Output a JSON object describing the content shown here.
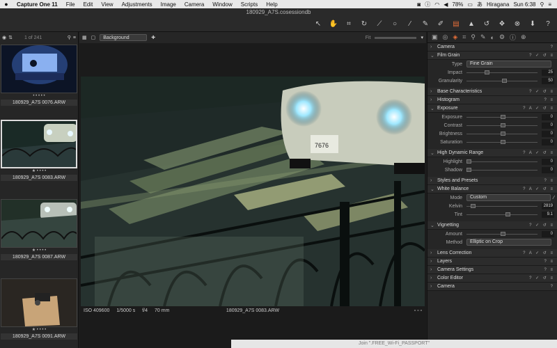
{
  "menubar": {
    "app": "Capture One 11",
    "items": [
      "File",
      "Edit",
      "View",
      "Adjustments",
      "Image",
      "Camera",
      "Window",
      "Scripts",
      "Help"
    ],
    "battery": "78%",
    "input_source": "Hiragana",
    "clock": "Sun 6:38"
  },
  "window": {
    "title": "180929_A7S.cosessiondb"
  },
  "browser": {
    "count": "1 of 241",
    "thumbs": [
      {
        "stars": "• • • • •",
        "name": "180929_A7S 0076.ARW"
      },
      {
        "stars": "★ • • • •",
        "name": "180929_A7S 0083.ARW"
      },
      {
        "stars": "★ • • • •",
        "name": "180929_A7S 0087.ARW"
      },
      {
        "stars": "★ • • • •",
        "name": "180929_A7S 0091.ARW"
      }
    ]
  },
  "viewer": {
    "layer_select": "Background",
    "fit_label": "Fit",
    "iso": "ISO 409600",
    "shutter": "1/5000 s",
    "aperture": "f/4",
    "focal": "70 mm",
    "filename": "180929_A7S 0083.ARW"
  },
  "tools": {
    "camera": "Camera",
    "film_grain": {
      "title": "Film Grain",
      "type_label": "Type",
      "type_value": "Fine Grain",
      "impact_label": "Impact",
      "impact_value": "25",
      "granularity_label": "Granularity",
      "granularity_value": "50"
    },
    "base_char": "Base Characteristics",
    "histogram": "Histogram",
    "exposure": {
      "title": "Exposure",
      "exposure_label": "Exposure",
      "exposure_value": "0",
      "contrast_label": "Contrast",
      "contrast_value": "0",
      "brightness_label": "Brightness",
      "brightness_value": "0",
      "saturation_label": "Saturation",
      "saturation_value": "0"
    },
    "hdr": {
      "title": "High Dynamic Range",
      "highlight_label": "Highlight",
      "highlight_value": "0",
      "shadow_label": "Shadow",
      "shadow_value": "0"
    },
    "styles": "Styles and Presets",
    "wb": {
      "title": "White Balance",
      "mode_label": "Mode",
      "mode_value": "Custom",
      "kelvin_label": "Kelvin",
      "kelvin_value": "2819",
      "tint_label": "Tint",
      "tint_value": "9.1"
    },
    "vignetting": {
      "title": "Vignetting",
      "amount_label": "Amount",
      "amount_value": "0",
      "method_label": "Method",
      "method_value": "Elliptic on Crop"
    },
    "lens": "Lens Correction",
    "layers": "Layers",
    "camera_settings": "Camera Settings",
    "color_editor": "Color Editor",
    "camera2": "Camera"
  },
  "notification": "Join \".FREE_Wi-Fi_PASSPORT\"",
  "colors": {
    "accent": "#e8703a",
    "panel": "#262626",
    "viewer_bg": "#1b1b1b"
  }
}
